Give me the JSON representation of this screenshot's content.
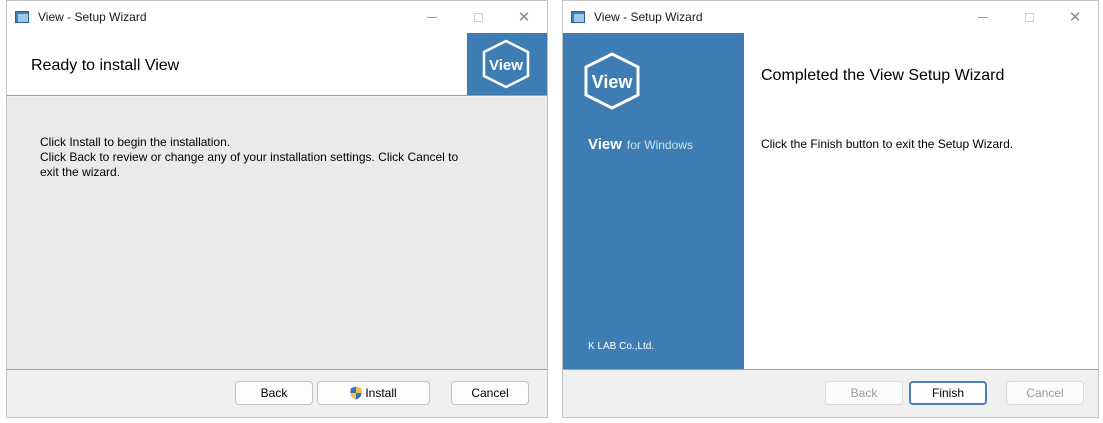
{
  "install_window": {
    "title": "View - Setup Wizard",
    "heading": "Ready to install View",
    "logo_text": "View",
    "message_lines": [
      "Click Install to begin the installation.",
      "Click Back to review or change any of your installation settings. Click Cancel to",
      "exit the wizard."
    ],
    "buttons": {
      "back": "Back",
      "install": "Install",
      "cancel": "Cancel"
    },
    "icons": {
      "app": "setup-app-icon",
      "install": "uac-shield-icon"
    }
  },
  "finish_window": {
    "title": "View - Setup Wizard",
    "logo_text": "View",
    "brand": "View",
    "brand_suffix": "for Windows",
    "company": "K LAB Co.,Ltd.",
    "heading": "Completed the View Setup Wizard",
    "message": "Click the Finish button to exit the Setup Wizard.",
    "buttons": {
      "back": "Back",
      "finish": "Finish",
      "cancel": "Cancel"
    },
    "button_states": {
      "back": "disabled",
      "finish": "default",
      "cancel": "disabled"
    }
  },
  "colors": {
    "brand_blue": "#3e7db4",
    "default_button_border": "#4a7fb8",
    "panel_gray": "#eaeaea"
  }
}
